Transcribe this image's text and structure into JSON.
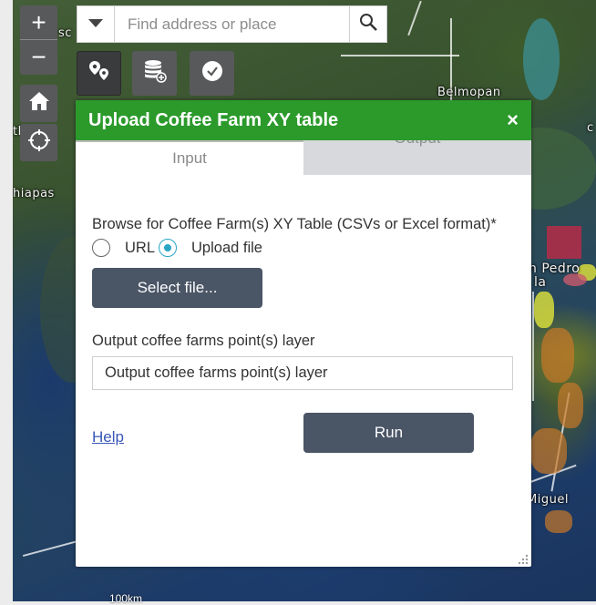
{
  "map": {
    "labels": {
      "belmopan": "Belmopan",
      "chiapas": "hiapas",
      "san_pedro": "n Pedro",
      "sula": "la",
      "miguel": "Miguel",
      "sc": "sc",
      "tl": "tl",
      "c_left": "c"
    },
    "scale_text": "100km"
  },
  "zoom": {
    "in_label": "+",
    "out_label": "−"
  },
  "search": {
    "placeholder": "Find address or place"
  },
  "panel": {
    "title": "Upload Coffee Farm XY table",
    "close_label": "×",
    "tabs": {
      "input": "Input",
      "output": "Output"
    },
    "browse_label": "Browse for Coffee Farm(s) XY Table (CSVs or Excel format)*",
    "radio_url": "URL",
    "radio_upload": "Upload file",
    "selected_source": "Upload file",
    "select_file_label": "Select file...",
    "output_label": "Output coffee farms point(s) layer",
    "output_value": "Output coffee farms point(s) layer",
    "help_label": "Help",
    "run_label": "Run"
  },
  "colors": {
    "header_green": "#2b9a2b",
    "button_slate": "#4a5566",
    "radio_accent": "#2aa6c4",
    "tool_gray": "#58595b"
  },
  "icons": {
    "search": "search-icon",
    "dropdown": "chevron-down-icon",
    "home": "home-icon",
    "locate": "locate-icon",
    "add_points": "map-pins-icon",
    "add_data": "database-add-icon",
    "analysis": "check-circle-icon"
  }
}
